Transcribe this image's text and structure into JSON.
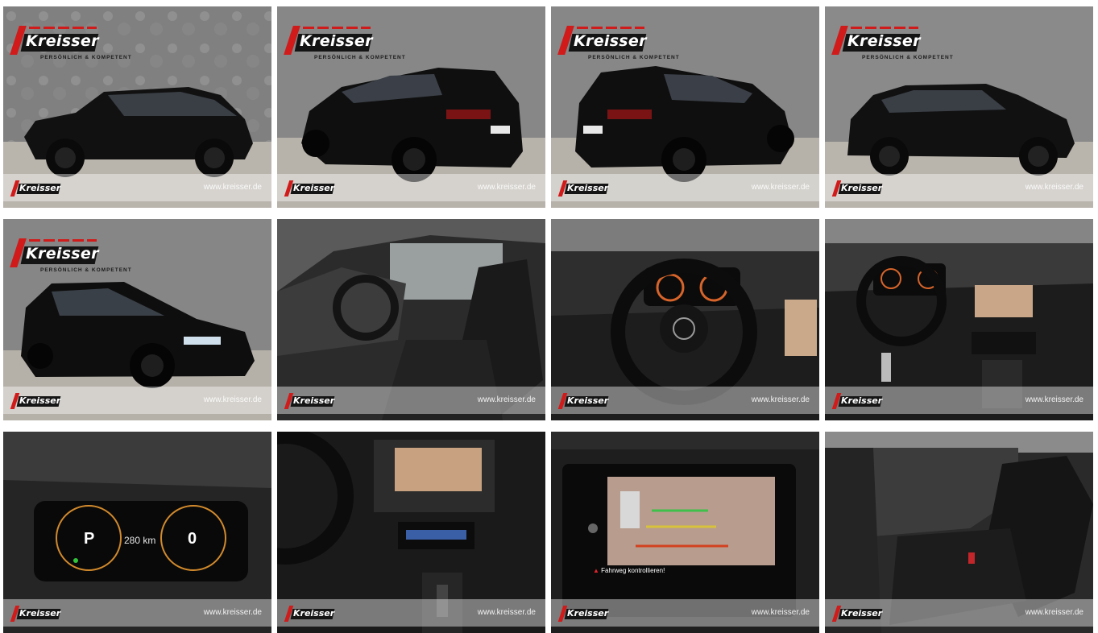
{
  "brand": {
    "name": "Kreisser",
    "tagline": "PERSÖNLICH & KOMPETENT",
    "url": "www.kreisser.de",
    "accent_color": "#d11a1a"
  },
  "gallery": [
    {
      "view": "side-left"
    },
    {
      "view": "rear-left"
    },
    {
      "view": "rear-right"
    },
    {
      "view": "side-right"
    },
    {
      "view": "front-left"
    },
    {
      "view": "interior-driver-door"
    },
    {
      "view": "steering-wheel"
    },
    {
      "view": "dashboard"
    },
    {
      "view": "instrument-cluster",
      "gear": "P",
      "range": "280",
      "range_unit": "km",
      "speed": "0"
    },
    {
      "view": "center-console"
    },
    {
      "view": "infotainment-camera",
      "warning": "Fahrweg kontrollieren!"
    },
    {
      "view": "rear-seats"
    }
  ]
}
